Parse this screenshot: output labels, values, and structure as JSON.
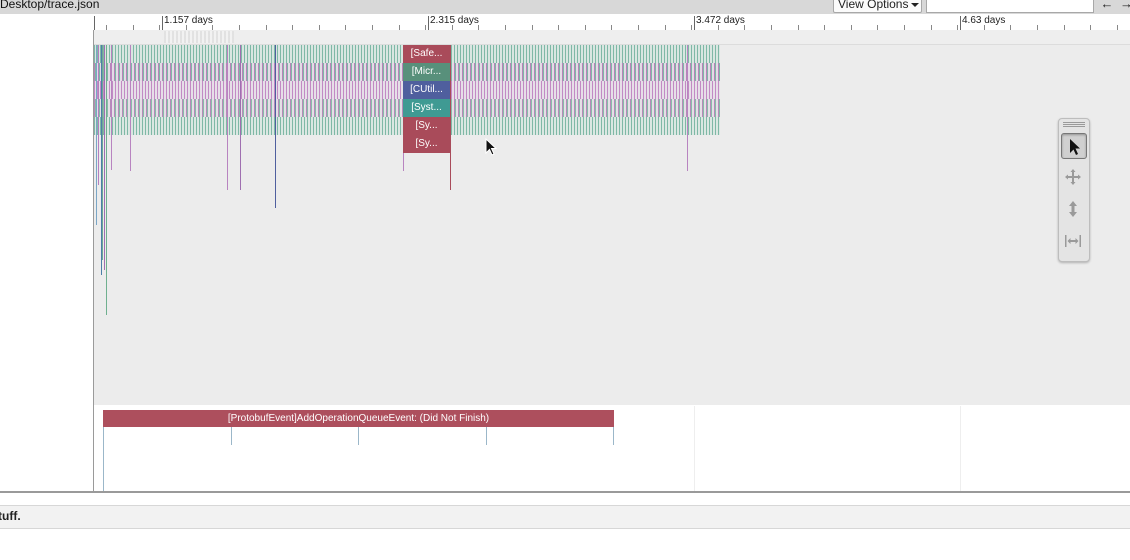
{
  "toolbar": {
    "file_title": "Desktop/trace.json",
    "view_options_label": "View Options",
    "search_value": "",
    "prev_label": "←",
    "next_label": "→"
  },
  "ruler": {
    "labels": [
      "1.157 days",
      "2.315 days",
      "3.472 days",
      "4.63 days"
    ]
  },
  "track1": {
    "slices": [
      "[Safe...",
      "[Micr...",
      "[CUtil...",
      "[Syst...",
      "[Sy...",
      "[Sy..."
    ],
    "slice_colors": [
      "#a94b5a",
      "#58907b",
      "#4f5f9e",
      "#3f9a93",
      "#a94b5a",
      "#a94b5a"
    ]
  },
  "tools": {
    "select_icon": "arrow-cursor-icon",
    "pan_icon": "move-arrows-icon",
    "zoom_icon": "vertical-zoom-icon",
    "timing_icon": "horizontal-range-icon"
  },
  "track2": {
    "event_label": "[ProtobufEvent]AddOperationQueueEvent: (Did Not Finish)",
    "event_color": "#ad4f5d"
  },
  "bottom_panel": {
    "label": "tuff."
  }
}
